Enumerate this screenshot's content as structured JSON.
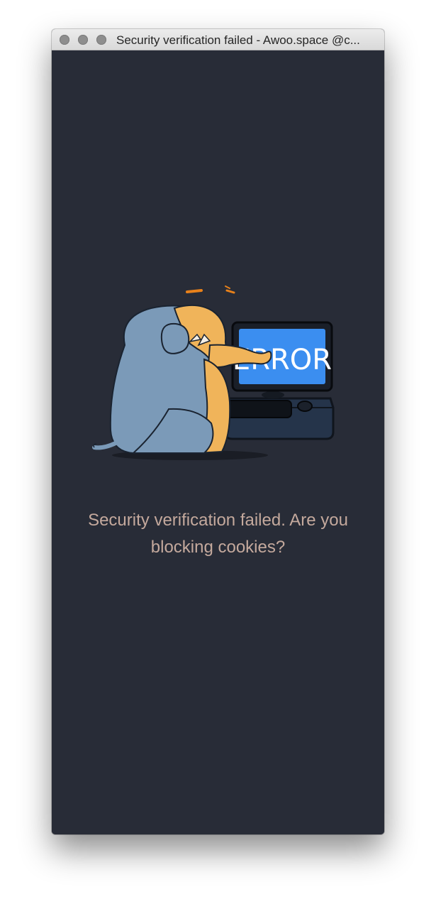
{
  "window": {
    "title": "Security verification failed - Awoo.space @c..."
  },
  "illustration": {
    "screen_text": "ERROR",
    "icon": "mastodon-error-illustration"
  },
  "message": {
    "text": "Security verification failed. Are you blocking cookies?"
  },
  "colors": {
    "background": "#282c37",
    "message": "#c4a99d",
    "screen": "#3b8ef0"
  }
}
